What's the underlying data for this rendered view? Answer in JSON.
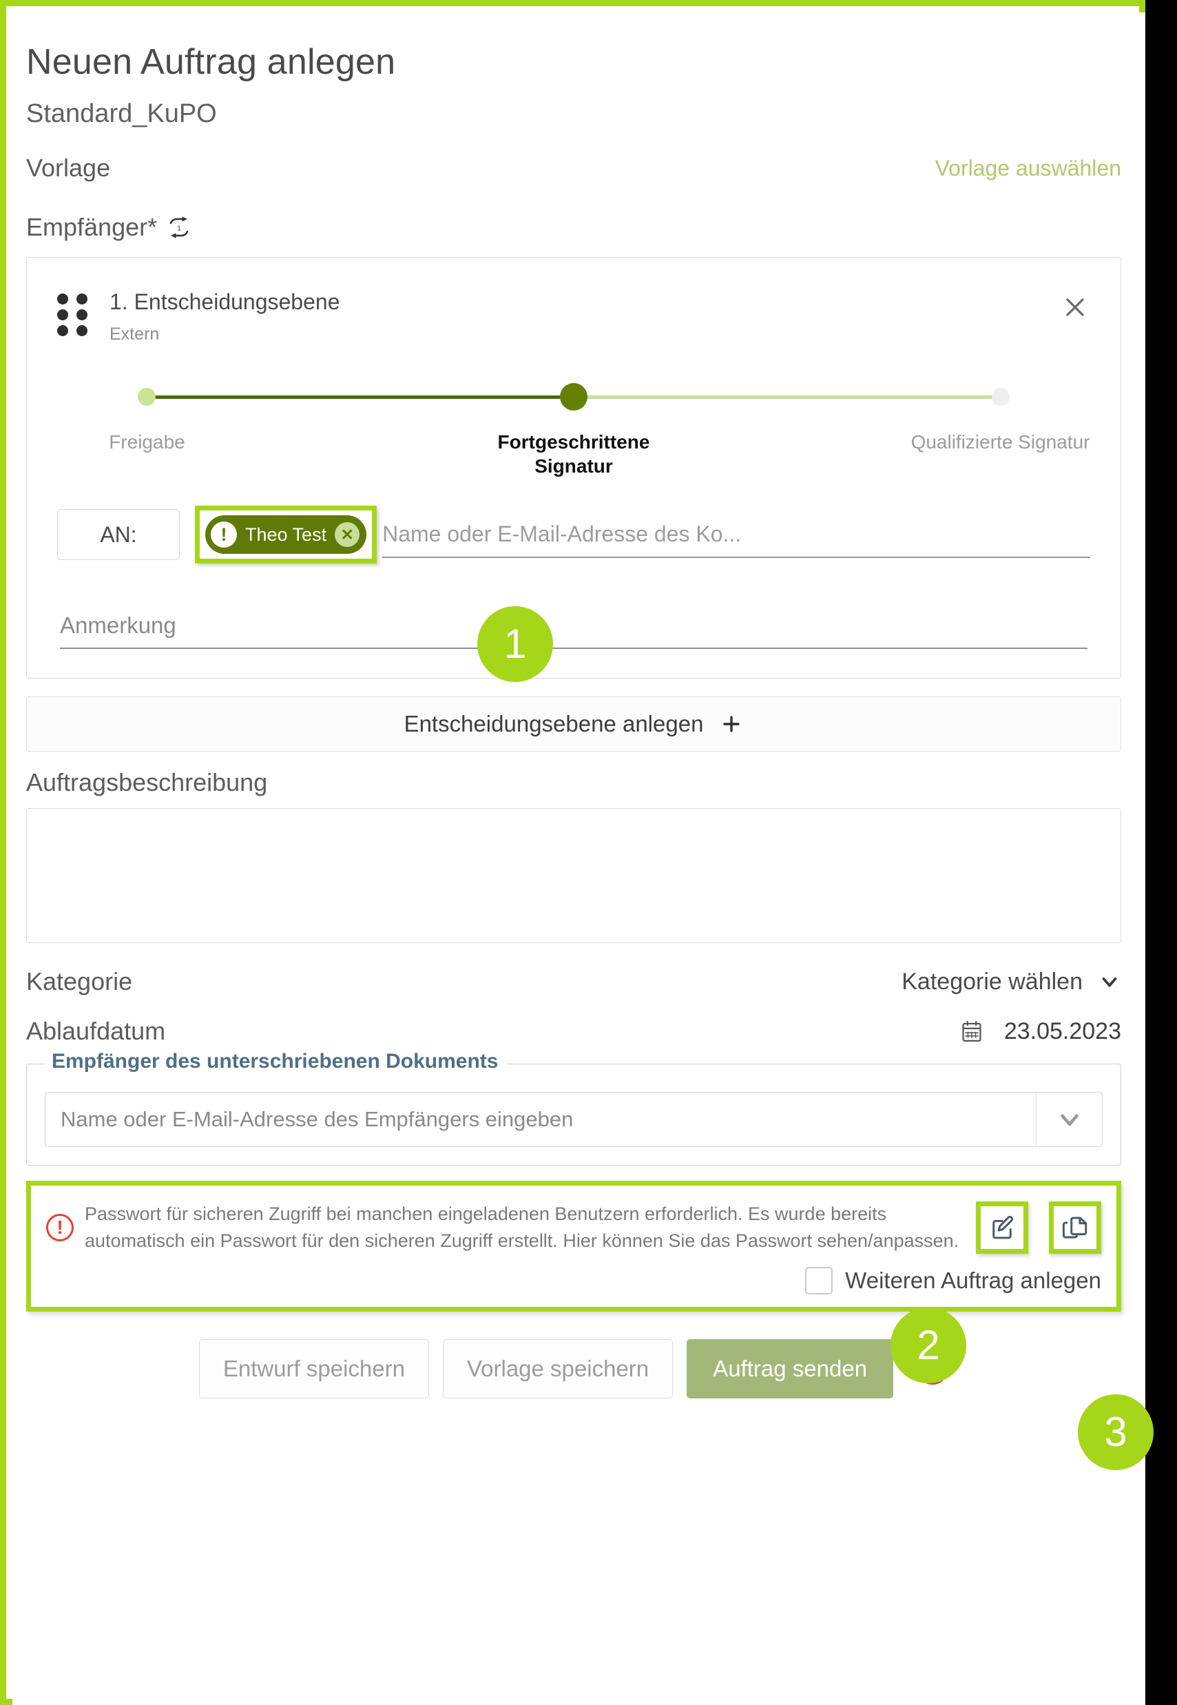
{
  "theme": {
    "accent_green": "#a6d619",
    "chip_green": "#5f7a06",
    "primary_button": "#a3b878",
    "warn_red": "#e8402a",
    "link_green": "#b2c96b"
  },
  "header": {
    "title": "Neuen Auftrag anlegen",
    "subtitle": "Standard_KuPO"
  },
  "template_row": {
    "label": "Vorlage",
    "action": "Vorlage auswählen"
  },
  "recipients": {
    "label": "Empfänger*",
    "swap_icon": "swap-recipients-icon",
    "card": {
      "drag_icon": "drag-handle-icon",
      "title": "1. Entscheidungsebene",
      "subtitle": "Extern",
      "close_icon": "close-icon",
      "stepper": {
        "steps": [
          {
            "label": "Freigabe",
            "state": "available"
          },
          {
            "label": "Fortgeschrittene Signatur",
            "state": "selected"
          },
          {
            "label": "Qualifizierte Signatur",
            "state": "disabled"
          }
        ]
      },
      "an_button": "AN:",
      "chip": {
        "warn_icon": "!",
        "name": "Theo Test",
        "remove_icon": "✕"
      },
      "recipient_placeholder": "Name oder E-Mail-Adresse des Ko...",
      "recipient_value": "",
      "note_placeholder": "Anmerkung",
      "note_value": ""
    },
    "add_level_button": "Entscheidungsebene anlegen",
    "add_level_icon": "plus-icon"
  },
  "description": {
    "label": "Auftragsbeschreibung",
    "value": "",
    "placeholder": ""
  },
  "category": {
    "label": "Kategorie",
    "selected": "Kategorie wählen",
    "caret_icon": "chevron-down-icon"
  },
  "expiry": {
    "label": "Ablaufdatum",
    "calendar_icon": "calendar-icon",
    "value": "23.05.2023"
  },
  "signed_doc_recipients": {
    "legend": "Empfänger des unterschriebenen Dokuments",
    "placeholder": "Name oder E-Mail-Adresse des Empfängers eingeben",
    "value": "",
    "caret_icon": "chevron-down-icon"
  },
  "password_notice": {
    "warn_icon": "!",
    "text": "Passwort für sicheren Zugriff bei manchen eingeladenen Benutzern erforderlich. Es wurde bereits automatisch ein Passwort für den sicheren Zugriff erstellt. Hier können Sie das Passwort sehen/anpassen.",
    "edit_icon": "edit-pencil-icon",
    "copy_icon": "copy-duplicate-icon"
  },
  "another_order": {
    "checkbox_checked": false,
    "label": "Weiteren Auftrag anlegen"
  },
  "footer": {
    "save_draft": "Entwurf speichern",
    "save_template": "Vorlage speichern",
    "send_order": "Auftrag senden",
    "info_icon": "info-icon"
  },
  "callouts": [
    {
      "number": "1"
    },
    {
      "number": "2"
    },
    {
      "number": "3"
    }
  ]
}
